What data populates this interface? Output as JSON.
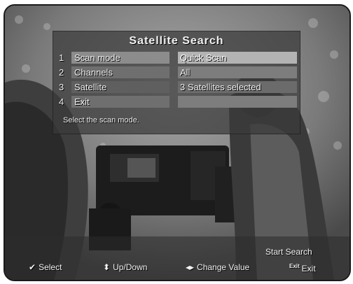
{
  "menu": {
    "title": "Satellite Search",
    "items": [
      {
        "num": "1",
        "label": "Scan mode",
        "value": "Quick Scan"
      },
      {
        "num": "2",
        "label": "Channels",
        "value": "All"
      },
      {
        "num": "3",
        "label": "Satellite",
        "value": "3 Satellites selected"
      },
      {
        "num": "4",
        "label": "Exit",
        "value": ""
      }
    ],
    "hint": "Select the scan mode."
  },
  "footer": {
    "select_label": "Select",
    "updown_label": "Up/Down",
    "change_label": "Change Value",
    "start_label": "Start Search",
    "exit_key": "Exit",
    "exit_label": "Exit"
  }
}
